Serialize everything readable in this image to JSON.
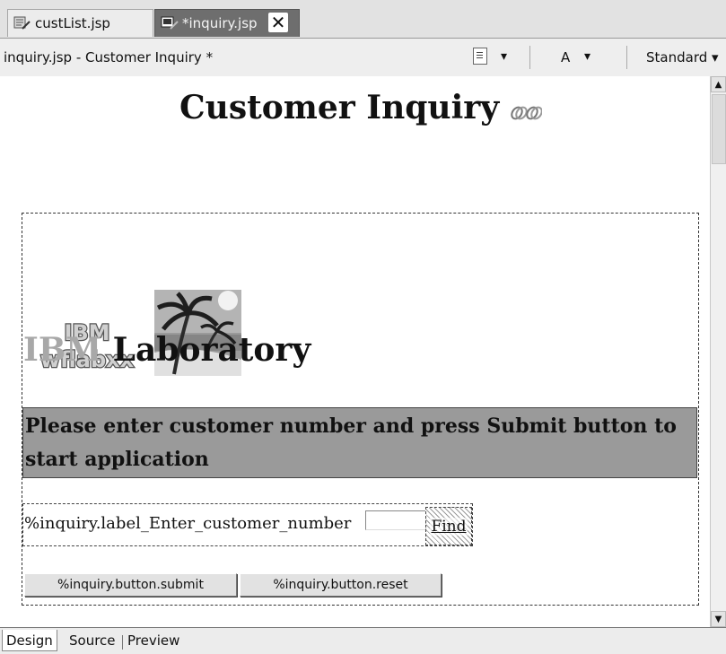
{
  "editor_tabs": [
    {
      "label": "custList.jsp",
      "active": false
    },
    {
      "label": "*inquiry.jsp",
      "active": true
    }
  ],
  "toolbar": {
    "document_title": "inquiry.jsp - Customer Inquiry *",
    "dropdown_arrow": "▾",
    "font_button": "A",
    "style_select": "Standard"
  },
  "page": {
    "heading": "Customer Inquiry",
    "logo_text": {
      "line1": "IBM",
      "line2": "wflabxx"
    },
    "lab_title": {
      "part1": "IBM",
      "part2": "Laboratory"
    },
    "banner": "Please enter customer number and press Submit button to start application",
    "customer_label": "%inquiry.label_Enter_customer_number",
    "customer_input_value": "",
    "find_button": "Find",
    "submit_button": "%inquiry.button.submit",
    "reset_button": "%inquiry.button.reset"
  },
  "scrollbar": {
    "up_arrow": "▲",
    "down_arrow": "▼"
  },
  "bottom_tabs": [
    {
      "label": "Design",
      "active": true
    },
    {
      "label": "Source",
      "active": false
    },
    {
      "label": "Preview",
      "active": false
    }
  ],
  "colors": {
    "banner_bg": "#9a9a9a",
    "active_tab_bg": "#6e6e6e",
    "ibm_gray": "#a8a8a8"
  },
  "icons": [
    "jsp-file-icon",
    "jsp-editor-icon",
    "close-icon",
    "page-properties-icon",
    "dropdown-arrow-icon",
    "link-chain-icon",
    "scroll-up-arrow-icon",
    "scroll-down-arrow-icon"
  ]
}
